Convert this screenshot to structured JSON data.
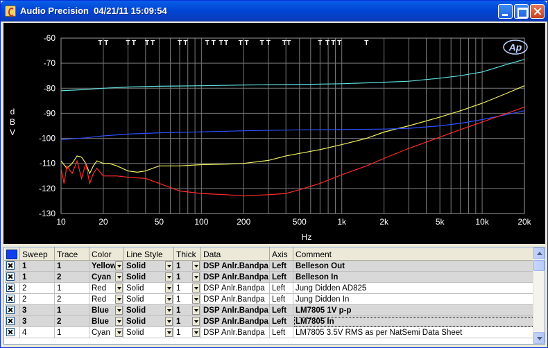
{
  "window": {
    "title": "Audio Precision  04/21/11 15:09:54"
  },
  "chart_data": {
    "type": "line",
    "title": "",
    "xlabel": "Hz",
    "ylabel": "dBV",
    "xscale": "log",
    "xlim": [
      10,
      20000
    ],
    "ylim": [
      -130,
      -60
    ],
    "xticks": [
      10,
      20,
      50,
      100,
      200,
      500,
      1000,
      2000,
      5000,
      10000,
      20000
    ],
    "xtick_labels": [
      "10",
      "20",
      "50",
      "100",
      "200",
      "500",
      "1k",
      "2k",
      "5k",
      "10k",
      "20k"
    ],
    "yticks": [
      -60,
      -70,
      -80,
      -90,
      -100,
      -110,
      -120,
      -130
    ],
    "ytick_labels": [
      "-60",
      "-70",
      "-80",
      "-90",
      "-100",
      "-110",
      "-120",
      "-130"
    ],
    "grid": true,
    "background": "#000000",
    "grid_color": "#7A7A7A",
    "logo": "Ap",
    "series": [
      {
        "color": "#5FE0E0",
        "x": [
          10,
          15,
          20,
          30,
          50,
          100,
          200,
          500,
          1000,
          2000,
          3000,
          5000,
          7000,
          10000,
          15000,
          20000
        ],
        "y": [
          -81,
          -80.5,
          -80,
          -79.5,
          -79.2,
          -79,
          -78.7,
          -78.5,
          -78.2,
          -77.6,
          -77.2,
          -76,
          -75,
          -73.5,
          -70.5,
          -68.5
        ]
      },
      {
        "color": "#F0F060",
        "x": [
          10,
          11,
          12,
          13,
          14,
          15,
          16,
          17,
          18,
          20,
          22,
          25,
          30,
          35,
          40,
          50,
          70,
          100,
          150,
          200,
          300,
          400,
          500,
          700,
          1000,
          1500,
          2000,
          3000,
          5000,
          7000,
          10000,
          15000,
          20000
        ],
        "y": [
          -109,
          -112,
          -110,
          -107,
          -107.5,
          -110,
          -114,
          -111,
          -109,
          -110,
          -110,
          -111,
          -113,
          -113.5,
          -113,
          -111,
          -111,
          -110.5,
          -110.3,
          -110,
          -108.8,
          -107,
          -106,
          -104.5,
          -102.5,
          -100,
          -97.5,
          -95,
          -91.5,
          -89,
          -86,
          -82,
          -79
        ]
      },
      {
        "color": "#3050FF",
        "x": [
          10,
          15,
          20,
          30,
          50,
          100,
          200,
          500,
          1000,
          2000,
          3000,
          5000,
          7000,
          10000,
          15000,
          20000
        ],
        "y": [
          -100.5,
          -99.8,
          -99,
          -98.3,
          -97.8,
          -97.4,
          -97,
          -96.6,
          -96.5,
          -96.3,
          -96,
          -95,
          -94,
          -92.5,
          -90.5,
          -89
        ]
      },
      {
        "color": "#FF2A2A",
        "x": [
          10,
          10.5,
          11,
          12,
          13,
          14,
          15,
          16,
          17,
          18,
          20,
          25,
          30,
          40,
          50,
          70,
          100,
          150,
          200,
          300,
          400,
          500,
          700,
          1000,
          1500,
          2000,
          3000,
          5000,
          7000,
          10000,
          15000,
          20000
        ],
        "y": [
          -112,
          -118,
          -111,
          -114,
          -109,
          -116,
          -110,
          -118,
          -114,
          -112,
          -115,
          -115,
          -115.5,
          -116,
          -118,
          -121,
          -122,
          -122.5,
          -123,
          -122.5,
          -122,
          -120.5,
          -118,
          -114.5,
          -111,
          -108,
          -104,
          -99.5,
          -96.5,
          -93.5,
          -90,
          -87.5
        ]
      }
    ],
    "markers_label": "T",
    "marker_x": [
      19,
      21,
      30,
      33,
      41,
      45,
      70,
      77,
      110,
      122,
      138,
      150,
      190,
      210,
      270,
      300,
      390,
      420,
      700,
      790,
      870,
      960,
      1500
    ]
  },
  "table": {
    "headers": [
      "Sweep",
      "Trace",
      "Color",
      "Line Style",
      "Thick",
      "Data",
      "Axis",
      "Comment"
    ],
    "corner_color": "#1040F0",
    "rows": [
      {
        "checked": true,
        "bold": true,
        "sweep": "1",
        "trace": "1",
        "color": "Yellow",
        "style": "Solid",
        "thick": "1",
        "data": "DSP Anlr.Bandpa",
        "axis": "Left",
        "comment": "Belleson Out"
      },
      {
        "checked": true,
        "bold": true,
        "sweep": "1",
        "trace": "2",
        "color": "Cyan",
        "style": "Solid",
        "thick": "1",
        "data": "DSP Anlr.Bandpa",
        "axis": "Left",
        "comment": "Belleson In"
      },
      {
        "checked": true,
        "bold": false,
        "sweep": "2",
        "trace": "1",
        "color": "Red",
        "style": "Solid",
        "thick": "1",
        "data": "DSP Anlr.Bandpa",
        "axis": "Left",
        "comment": "Jung Didden AD825"
      },
      {
        "checked": true,
        "bold": false,
        "sweep": "2",
        "trace": "2",
        "color": "Red",
        "style": "Solid",
        "thick": "1",
        "data": "DSP Anlr.Bandpa",
        "axis": "Left",
        "comment": "Jung Didden In"
      },
      {
        "checked": true,
        "bold": true,
        "sweep": "3",
        "trace": "1",
        "color": "Blue",
        "style": "Solid",
        "thick": "1",
        "data": "DSP Anlr.Bandpa",
        "axis": "Left",
        "comment": "LM7805 1V p-p"
      },
      {
        "checked": true,
        "bold": true,
        "sweep": "3",
        "trace": "2",
        "color": "Blue",
        "style": "Solid",
        "thick": "1",
        "data": "DSP Anlr.Bandpa",
        "axis": "Left",
        "comment": "LM7805 In"
      },
      {
        "checked": true,
        "bold": false,
        "sweep": "4",
        "trace": "1",
        "color": "Cyan",
        "style": "Solid",
        "thick": "1",
        "data": "DSP Anlr.Bandpa",
        "axis": "Left",
        "comment": "LM7805 3.5V RMS as per NatSemi Data Sheet"
      }
    ]
  }
}
